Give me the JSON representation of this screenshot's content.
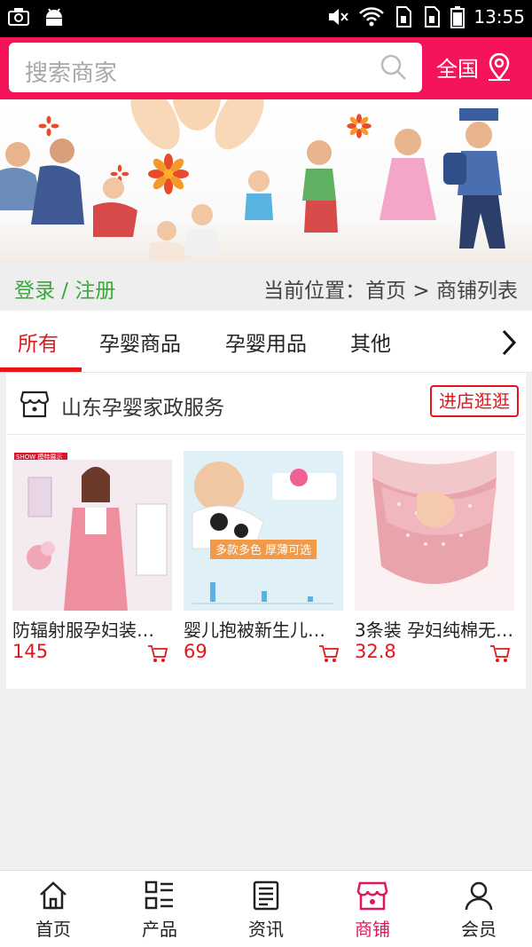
{
  "status_bar": {
    "time": "13:55"
  },
  "header": {
    "search_placeholder": "搜索商家",
    "region_label": "全国"
  },
  "breadcrumb": {
    "login_label": "登录 / 注册",
    "path": "当前位置：首页 > 商铺列表"
  },
  "tabs": [
    {
      "label": "所有",
      "active": true
    },
    {
      "label": "孕婴商品"
    },
    {
      "label": "孕婴用品"
    },
    {
      "label": "其他"
    }
  ],
  "shop": {
    "name": "山东孕婴家政服务",
    "visit_label": "进店逛逛",
    "products": [
      {
        "title": "防辐射服孕妇装…",
        "price": "145",
        "image_text": "SHOW 模特展示"
      },
      {
        "title": "婴儿抱被新生儿…",
        "price": "69",
        "image_text": "多款多色 厚薄可选"
      },
      {
        "title": "3条装 孕妇纯棉无…",
        "price": "32.8"
      }
    ]
  },
  "bottom_nav": [
    {
      "label": "首页",
      "icon": "home-icon"
    },
    {
      "label": "产品",
      "icon": "grid-list-icon"
    },
    {
      "label": "资讯",
      "icon": "news-icon"
    },
    {
      "label": "商铺",
      "icon": "shop-icon",
      "active": true
    },
    {
      "label": "会员",
      "icon": "user-icon"
    }
  ],
  "colors": {
    "brand": "#f5145a",
    "accent_red": "#e3161a",
    "login_green": "#3aa83a"
  }
}
